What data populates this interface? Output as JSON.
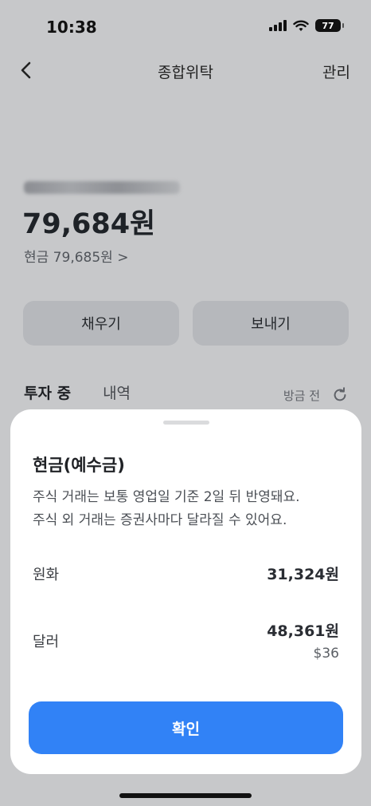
{
  "status_bar": {
    "time": "10:38",
    "battery": "77"
  },
  "nav": {
    "title": "종합위탁",
    "manage": "관리"
  },
  "account": {
    "balance": "79,684원",
    "cash_link": "현금 79,685원 >"
  },
  "actions": {
    "fill": "채우기",
    "send": "보내기"
  },
  "tabs": {
    "investing": "투자 중",
    "history": "내역",
    "refresh_label": "방금 전"
  },
  "sheet": {
    "title": "현금(예수금)",
    "desc_line1": "주식 거래는 보통 영업일 기준 2일 뒤 반영돼요.",
    "desc_line2": "주식 외 거래는 증권사마다 달라질 수 있어요.",
    "krw_label": "원화",
    "krw_value": "31,324원",
    "usd_label": "달러",
    "usd_value": "48,361원",
    "usd_sub": "$36",
    "confirm": "확인"
  },
  "colors": {
    "accent": "#3182f6",
    "dim_bg": "#c7c8ca"
  }
}
